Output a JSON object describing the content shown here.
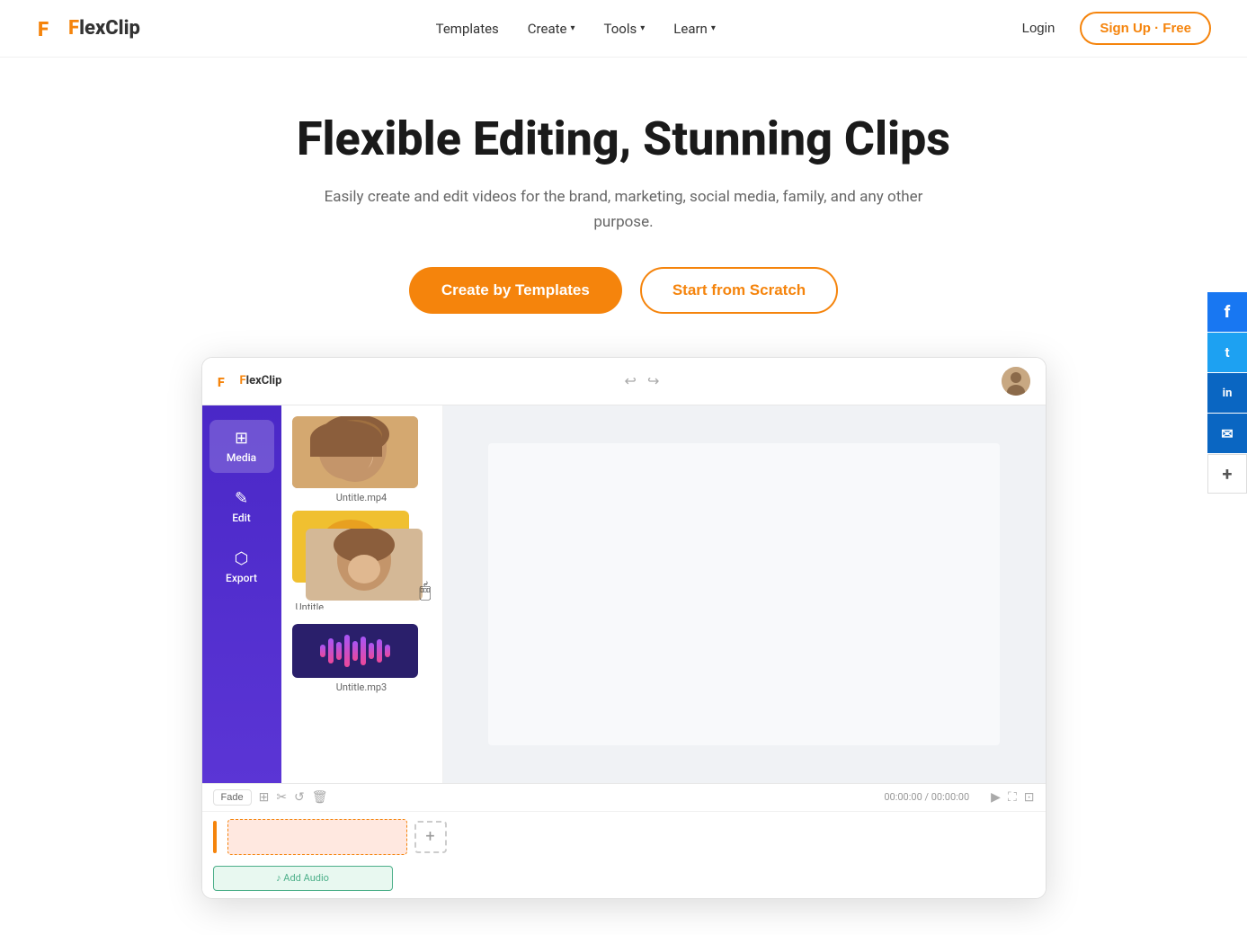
{
  "brand": {
    "name": "FlexClip",
    "logo_color_f": "#f5840c",
    "logo_color_lex": "#4a28c7"
  },
  "navbar": {
    "templates_label": "Templates",
    "create_label": "Create",
    "tools_label": "Tools",
    "learn_label": "Learn",
    "login_label": "Login",
    "signup_label": "Sign Up · Free"
  },
  "hero": {
    "title": "Flexible Editing, Stunning Clips",
    "subtitle": "Easily create and edit videos for the brand, marketing, social media, family, and any other purpose.",
    "btn_primary": "Create by Templates",
    "btn_outline": "Start from Scratch"
  },
  "editor": {
    "logo": "FlexClip",
    "sidebar_items": [
      {
        "label": "Media",
        "icon": "⊞"
      },
      {
        "label": "Edit",
        "icon": "✎"
      },
      {
        "label": "Export",
        "icon": "⬡"
      }
    ],
    "media_files": [
      {
        "name": "Untitle.mp4",
        "type": "video1"
      },
      {
        "name": "Untitle",
        "type": "video2"
      },
      {
        "name": "Untitle.mp3",
        "type": "audio"
      }
    ],
    "timeline": {
      "fade_label": "Fade",
      "time_display": "00:00:00 / 00:00:00",
      "add_audio_label": "♪ Add Audio"
    }
  },
  "social": {
    "buttons": [
      {
        "name": "facebook",
        "icon": "f"
      },
      {
        "name": "twitter",
        "icon": "t"
      },
      {
        "name": "linkedin",
        "icon": "in"
      },
      {
        "name": "email",
        "icon": "✉"
      },
      {
        "name": "more",
        "icon": "+"
      }
    ]
  }
}
